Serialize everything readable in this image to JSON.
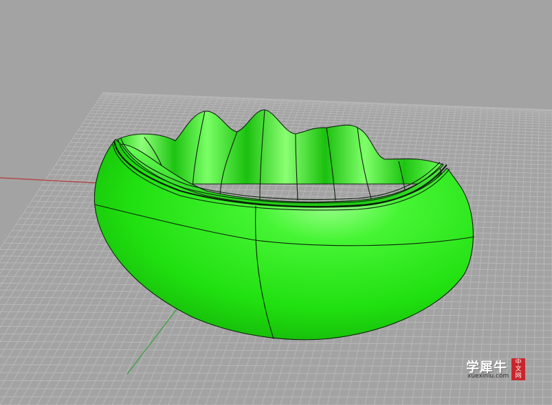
{
  "viewport": {
    "background": "#a3a3a3",
    "grid_color": "#b8b8b8",
    "grid_major_color": "#c4c4c4",
    "x_axis_color": "#b04a4a",
    "y_axis_color": "#4aa04a",
    "model_color": "#22ee11",
    "edge_color": "#0c1f0c"
  },
  "watermark": {
    "main": "学犀牛",
    "url": "xuexiniu.com",
    "stamp": [
      "中",
      "文",
      "网"
    ]
  }
}
